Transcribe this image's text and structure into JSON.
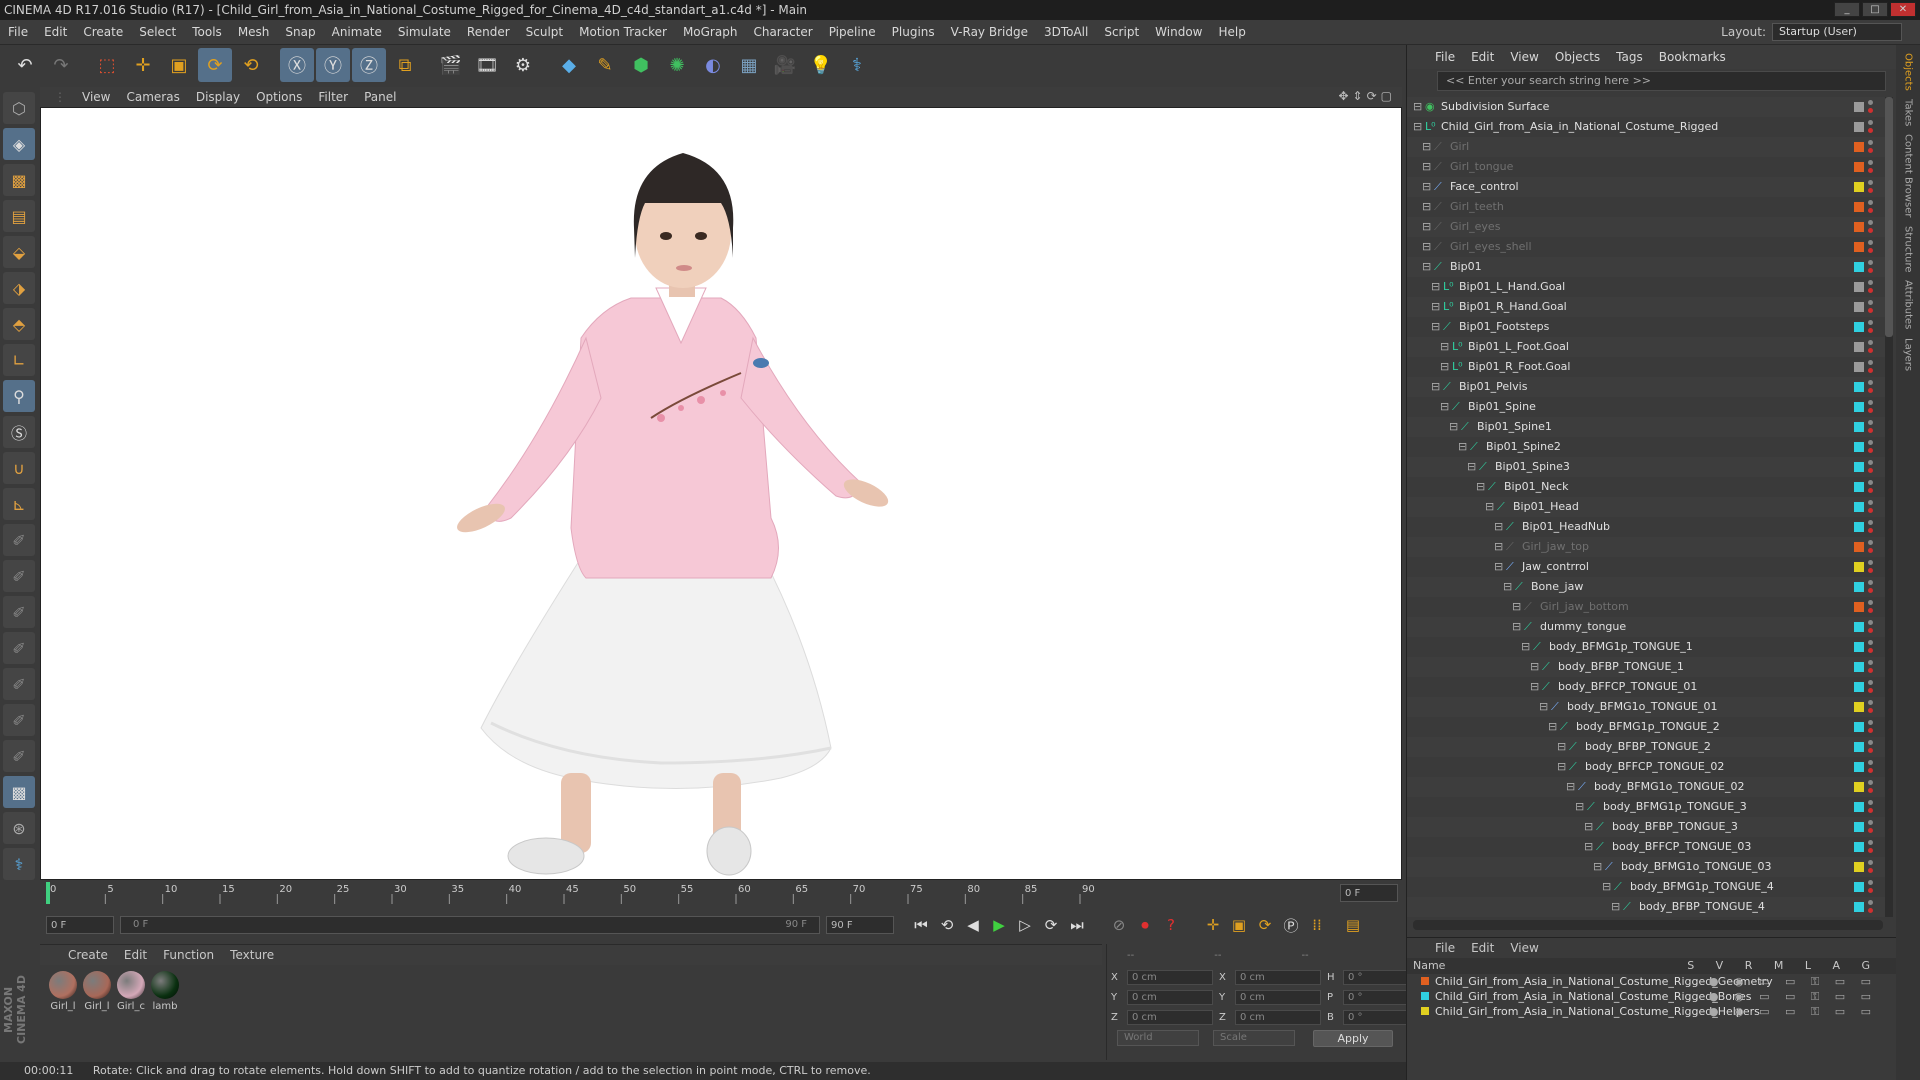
{
  "window": {
    "title": "CINEMA 4D R17.016 Studio (R17) - [Child_Girl_from_Asia_in_National_Costume_Rigged_for_Cinema_4D_c4d_standart_a1.c4d *] - Main"
  },
  "menubar": {
    "items": [
      "File",
      "Edit",
      "Create",
      "Select",
      "Tools",
      "Mesh",
      "Snap",
      "Animate",
      "Simulate",
      "Render",
      "Sculpt",
      "Motion Tracker",
      "MoGraph",
      "Character",
      "Pipeline",
      "Plugins",
      "V-Ray Bridge",
      "3DToAll",
      "Script",
      "Window",
      "Help"
    ],
    "layout_label": "Layout:",
    "layout_value": "Startup (User)"
  },
  "viewport_menu": {
    "items": [
      "View",
      "Cameras",
      "Display",
      "Options",
      "Filter",
      "Panel"
    ]
  },
  "timeline": {
    "ticks": [
      "0",
      "5",
      "10",
      "15",
      "20",
      "25",
      "30",
      "35",
      "40",
      "45",
      "50",
      "55",
      "60",
      "65",
      "70",
      "75",
      "80",
      "85",
      "90"
    ],
    "current_frame": "0 F"
  },
  "transport": {
    "start_field": "0 F",
    "range_start": "0 F",
    "range_end": "90 F",
    "end_field": "90 F"
  },
  "material_manager": {
    "menu": [
      "Create",
      "Edit",
      "Function",
      "Texture"
    ],
    "materials": [
      {
        "label": "Girl_l",
        "color": "#b07060"
      },
      {
        "label": "Girl_l",
        "color": "#a86858"
      },
      {
        "label": "Girl_c",
        "color": "#d4a8b8"
      },
      {
        "label": "lamb",
        "color": "#0a3010"
      }
    ]
  },
  "coordinates": {
    "header": [
      "--",
      "--",
      "--"
    ],
    "rows": [
      {
        "a": "X",
        "av": "0 cm",
        "b": "X",
        "bv": "0 cm",
        "c": "H",
        "cv": "0 °"
      },
      {
        "a": "Y",
        "av": "0 cm",
        "b": "Y",
        "bv": "0 cm",
        "c": "P",
        "cv": "0 °"
      },
      {
        "a": "Z",
        "av": "0 cm",
        "b": "Z",
        "bv": "0 cm",
        "c": "B",
        "cv": "0 °"
      }
    ],
    "world": "World",
    "scale": "Scale",
    "apply": "Apply"
  },
  "status": {
    "time": "00:00:11",
    "message": "Rotate: Click and drag to rotate elements. Hold down SHIFT to add to quantize rotation / add to the selection in point mode, CTRL to remove."
  },
  "object_manager": {
    "menu": [
      "File",
      "Edit",
      "View",
      "Objects",
      "Tags",
      "Bookmarks"
    ],
    "search_placeholder": "<< Enter your search string here >>",
    "objects": [
      {
        "name": "Subdivision Surface",
        "depth": 0,
        "dim": false,
        "tag": "#9a9a9a"
      },
      {
        "name": "Child_Girl_from_Asia_in_National_Costume_Rigged",
        "depth": 0,
        "dim": false,
        "tag": "#9a9a9a"
      },
      {
        "name": "Girl",
        "depth": 1,
        "dim": true,
        "tag": "#e06020"
      },
      {
        "name": "Girl_tongue",
        "depth": 1,
        "dim": true,
        "tag": "#e06020"
      },
      {
        "name": "Face_control",
        "depth": 1,
        "dim": false,
        "tag": "#e0d020"
      },
      {
        "name": "Girl_teeth",
        "depth": 1,
        "dim": true,
        "tag": "#e06020"
      },
      {
        "name": "Girl_eyes",
        "depth": 1,
        "dim": true,
        "tag": "#e06020"
      },
      {
        "name": "Girl_eyes_shell",
        "depth": 1,
        "dim": true,
        "tag": "#e06020"
      },
      {
        "name": "Bip01",
        "depth": 1,
        "dim": false,
        "tag": "#30d0e0"
      },
      {
        "name": "Bip01_L_Hand.Goal",
        "depth": 2,
        "dim": false,
        "tag": "#9a9a9a"
      },
      {
        "name": "Bip01_R_Hand.Goal",
        "depth": 2,
        "dim": false,
        "tag": "#9a9a9a"
      },
      {
        "name": "Bip01_Footsteps",
        "depth": 2,
        "dim": false,
        "tag": "#30d0e0"
      },
      {
        "name": "Bip01_L_Foot.Goal",
        "depth": 3,
        "dim": false,
        "tag": "#9a9a9a"
      },
      {
        "name": "Bip01_R_Foot.Goal",
        "depth": 3,
        "dim": false,
        "tag": "#9a9a9a"
      },
      {
        "name": "Bip01_Pelvis",
        "depth": 2,
        "dim": false,
        "tag": "#30d0e0"
      },
      {
        "name": "Bip01_Spine",
        "depth": 3,
        "dim": false,
        "tag": "#30d0e0"
      },
      {
        "name": "Bip01_Spine1",
        "depth": 4,
        "dim": false,
        "tag": "#30d0e0"
      },
      {
        "name": "Bip01_Spine2",
        "depth": 5,
        "dim": false,
        "tag": "#30d0e0"
      },
      {
        "name": "Bip01_Spine3",
        "depth": 6,
        "dim": false,
        "tag": "#30d0e0"
      },
      {
        "name": "Bip01_Neck",
        "depth": 7,
        "dim": false,
        "tag": "#30d0e0"
      },
      {
        "name": "Bip01_Head",
        "depth": 8,
        "dim": false,
        "tag": "#30d0e0"
      },
      {
        "name": "Bip01_HeadNub",
        "depth": 9,
        "dim": false,
        "tag": "#30d0e0"
      },
      {
        "name": "Girl_jaw_top",
        "depth": 9,
        "dim": true,
        "tag": "#e06020"
      },
      {
        "name": "Jaw_contrrol",
        "depth": 9,
        "dim": false,
        "tag": "#e0d020"
      },
      {
        "name": "Bone_jaw",
        "depth": 10,
        "dim": false,
        "tag": "#30d0e0"
      },
      {
        "name": "Girl_jaw_bottom",
        "depth": 11,
        "dim": true,
        "tag": "#e06020"
      },
      {
        "name": "dummy_tongue",
        "depth": 11,
        "dim": false,
        "tag": "#30d0e0"
      },
      {
        "name": "body_BFMG1p_TONGUE_1",
        "depth": 12,
        "dim": false,
        "tag": "#30d0e0"
      },
      {
        "name": "body_BFBP_TONGUE_1",
        "depth": 13,
        "dim": false,
        "tag": "#30d0e0"
      },
      {
        "name": "body_BFFCP_TONGUE_01",
        "depth": 13,
        "dim": false,
        "tag": "#30d0e0"
      },
      {
        "name": "body_BFMG1o_TONGUE_01",
        "depth": 14,
        "dim": false,
        "tag": "#e0d020"
      },
      {
        "name": "body_BFMG1p_TONGUE_2",
        "depth": 15,
        "dim": false,
        "tag": "#30d0e0"
      },
      {
        "name": "body_BFBP_TONGUE_2",
        "depth": 16,
        "dim": false,
        "tag": "#30d0e0"
      },
      {
        "name": "body_BFFCP_TONGUE_02",
        "depth": 16,
        "dim": false,
        "tag": "#30d0e0"
      },
      {
        "name": "body_BFMG1o_TONGUE_02",
        "depth": 17,
        "dim": false,
        "tag": "#e0d020"
      },
      {
        "name": "body_BFMG1p_TONGUE_3",
        "depth": 18,
        "dim": false,
        "tag": "#30d0e0"
      },
      {
        "name": "body_BFBP_TONGUE_3",
        "depth": 19,
        "dim": false,
        "tag": "#30d0e0"
      },
      {
        "name": "body_BFFCP_TONGUE_03",
        "depth": 19,
        "dim": false,
        "tag": "#30d0e0"
      },
      {
        "name": "body_BFMG1o_TONGUE_03",
        "depth": 20,
        "dim": false,
        "tag": "#e0d020"
      },
      {
        "name": "body_BFMG1p_TONGUE_4",
        "depth": 21,
        "dim": false,
        "tag": "#30d0e0"
      },
      {
        "name": "body_BFBP_TONGUE_4",
        "depth": 22,
        "dim": false,
        "tag": "#30d0e0"
      }
    ]
  },
  "layer_manager": {
    "menu": [
      "File",
      "Edit",
      "View"
    ],
    "name_header": "Name",
    "columns": "S V R M L A G",
    "layers": [
      {
        "name": "Child_Girl_from_Asia_in_National_Costume_Rigged_Geometry",
        "color": "#e06020"
      },
      {
        "name": "Child_Girl_from_Asia_in_National_Costume_Rigged_Bones",
        "color": "#30d0e0"
      },
      {
        "name": "Child_Girl_from_Asia_in_National_Costume_Rigged_Helpers",
        "color": "#e0d020"
      }
    ]
  },
  "side_tabs": [
    "Objects",
    "Takes",
    "Content Browser",
    "Structure",
    "Attributes",
    "Layers"
  ]
}
